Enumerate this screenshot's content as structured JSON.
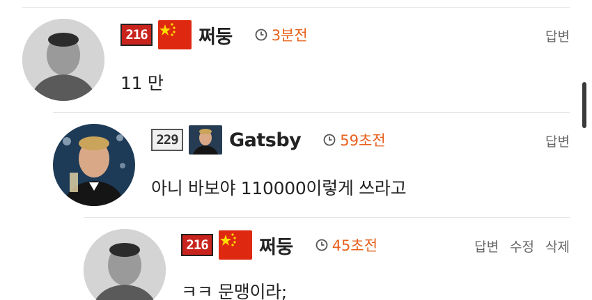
{
  "comments": [
    {
      "level": "216",
      "badge": "china-flag",
      "nickname": "쩌둥",
      "time": "3분전",
      "actions": [
        "답변"
      ],
      "text": "11 만"
    },
    {
      "level": "229",
      "badge": "gatsby-avatar",
      "nickname": "Gatsby",
      "time": "59초전",
      "actions": [
        "답변"
      ],
      "text": "아니 바보야 110000이렇게 쓰라고"
    },
    {
      "level": "216",
      "badge": "china-flag",
      "nickname": "쩌둥",
      "time": "45초전",
      "actions": [
        "답변",
        "수정",
        "삭제"
      ],
      "text": "ㅋㅋ 문맹이라;"
    }
  ],
  "colors": {
    "time": "#e8601c",
    "level_red": "#c8231c",
    "divider": "#e6e6e6"
  }
}
